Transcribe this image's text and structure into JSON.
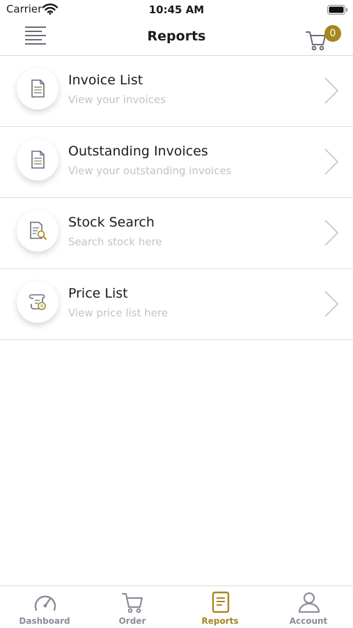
{
  "status_bar": {
    "carrier": "Carrier",
    "time": "10:45 AM"
  },
  "header": {
    "title": "Reports",
    "cart_count": "0",
    "menu_icon": "hamburger-menu-icon",
    "cart_icon": "shopping-cart-icon"
  },
  "reports": [
    {
      "title": "Invoice List",
      "subtitle": "View your invoices",
      "icon": "invoice-document-icon"
    },
    {
      "title": "Outstanding Invoices",
      "subtitle": "View your outstanding invoices",
      "icon": "invoice-document-icon"
    },
    {
      "title": "Stock Search",
      "subtitle": "Search stock here",
      "icon": "document-search-icon"
    },
    {
      "title": "Price List",
      "subtitle": "View price list here",
      "icon": "price-scroll-icon"
    }
  ],
  "tabs": [
    {
      "label": "Dashboard",
      "icon": "speedometer-icon",
      "active": false
    },
    {
      "label": "Order",
      "icon": "shopping-cart-icon",
      "active": false
    },
    {
      "label": "Reports",
      "icon": "report-document-icon",
      "active": true
    },
    {
      "label": "Account",
      "icon": "user-icon",
      "active": false
    }
  ],
  "colors": {
    "accent": "#a6871f",
    "tab_inactive": "#8c8c9a",
    "subtitle": "#c3c3c3",
    "divider": "#dedede"
  }
}
